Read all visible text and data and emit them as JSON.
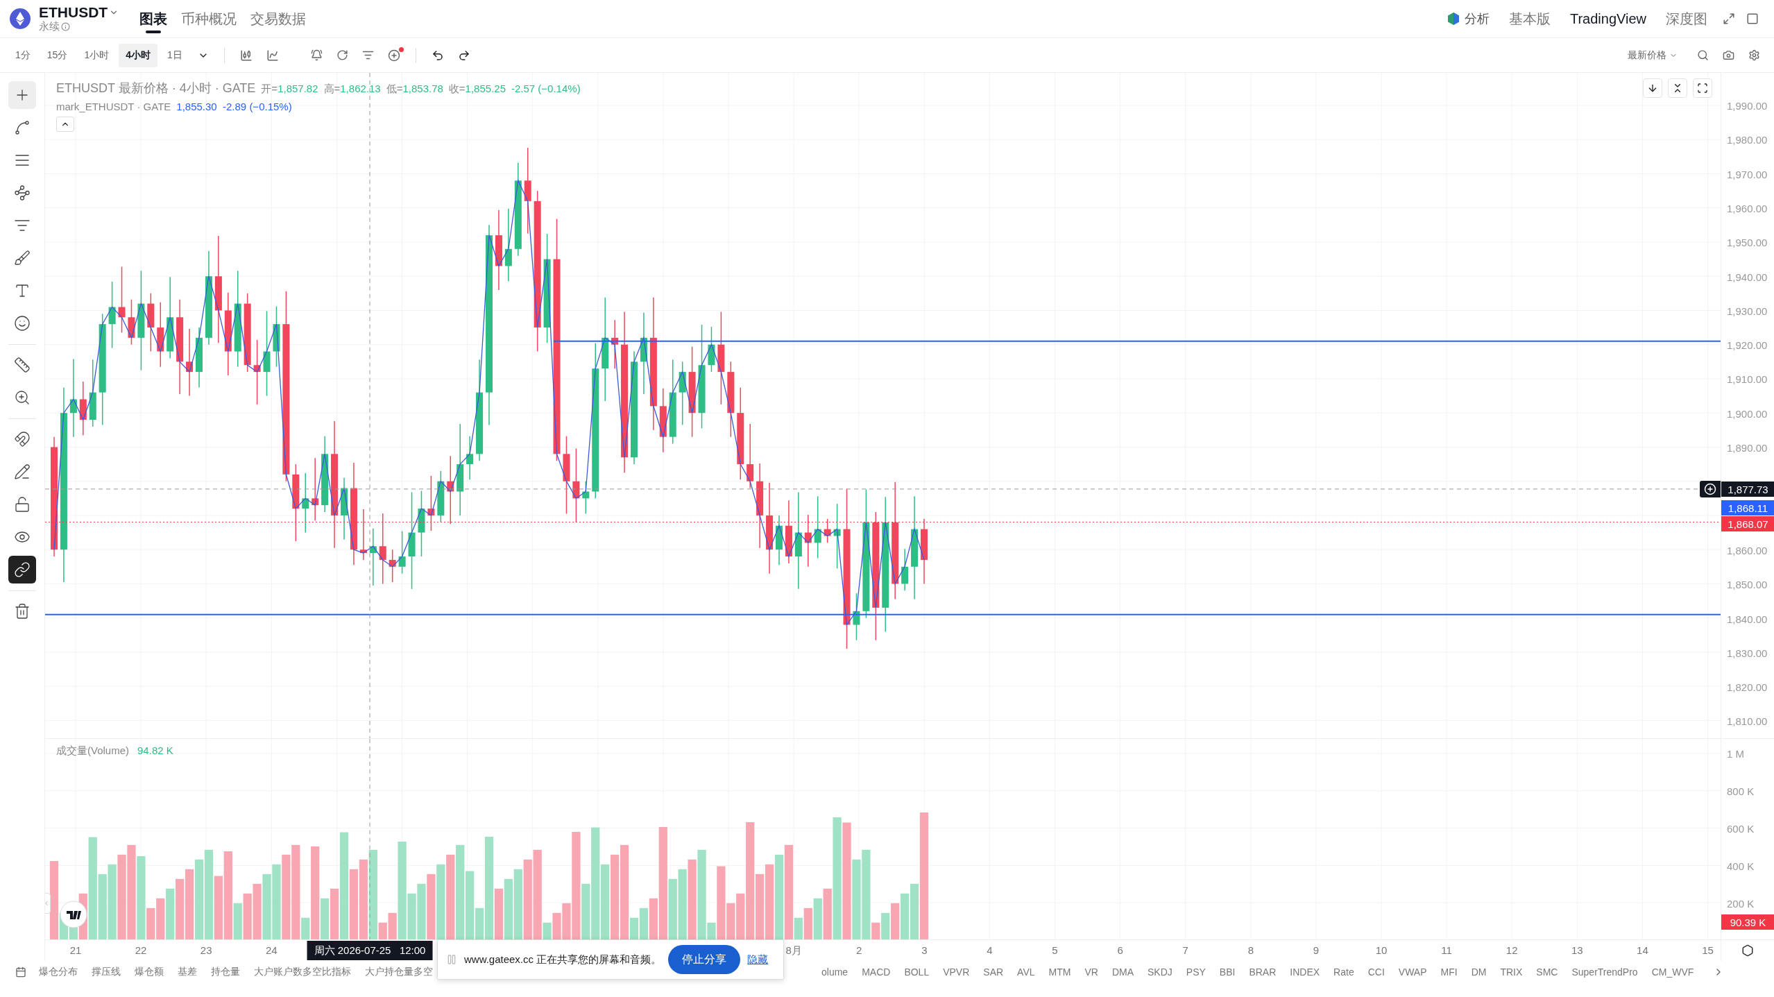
{
  "header": {
    "symbol": "ETHUSDT",
    "contract": "永续",
    "tabs": [
      {
        "label": "图表",
        "selected": true
      },
      {
        "label": "币种概况",
        "selected": false
      },
      {
        "label": "交易数据",
        "selected": false
      }
    ],
    "ai_label": "分析",
    "views": [
      {
        "label": "基本版",
        "selected": false
      },
      {
        "label": "TradingView",
        "selected": true
      },
      {
        "label": "深度图",
        "selected": false
      }
    ]
  },
  "toolbar": {
    "intervals": [
      {
        "label": "1分",
        "selected": false
      },
      {
        "label": "15分",
        "selected": false
      },
      {
        "label": "1小时",
        "selected": false
      },
      {
        "label": "4小时",
        "selected": true
      },
      {
        "label": "1日",
        "selected": false
      }
    ],
    "price_source": "最新价格"
  },
  "drawing_tools": [
    {
      "selected": true
    },
    {
      "selected": false
    },
    {
      "selected": false
    },
    {
      "selected": false
    },
    {
      "selected": false
    },
    {
      "selected": false
    },
    {
      "selected": false
    },
    {
      "selected": false
    },
    {
      "selected": false
    },
    {
      "selected": false
    },
    {
      "selected": false
    },
    {
      "selected": false
    },
    {
      "selected": false
    },
    {
      "selected": false
    },
    {
      "selected": true
    },
    {
      "selected": false
    }
  ],
  "legend": {
    "title": "ETHUSDT 最新价格 · 4小时 · GATE",
    "ohlc": [
      {
        "label": "开=",
        "value": "1,857.82"
      },
      {
        "label": "高=",
        "value": "1,862.13"
      },
      {
        "label": "低=",
        "value": "1,853.78"
      },
      {
        "label": "收=",
        "value": "1,855.25"
      }
    ],
    "change": "-2.57 (−0.14%)",
    "mark_title": "mark_ETHUSDT · GATE",
    "mark_values": "1,855.30  -2.89 (−0.15%)"
  },
  "price_axis": {
    "labels_above": [
      "1,990.00",
      "1,980.00",
      "1,970.00",
      "1,960.00",
      "1,950.00",
      "1,940.00",
      "1,930.00",
      "1,920.00",
      "1,910.00",
      "1,900.00",
      "1,890.00"
    ],
    "labels_below": [
      "1,860.00",
      "1,850.00",
      "1,840.00",
      "1,830.00",
      "1,820.00",
      "1,810.00"
    ],
    "tags": [
      {
        "text": "1,877.73",
        "color": "#131722"
      },
      {
        "text": "1,868.11",
        "color": "#2962ff"
      },
      {
        "text": "1,868.07",
        "color": "#f23645"
      }
    ]
  },
  "volume": {
    "title": "成交量(Volume)",
    "value": "94.82 K",
    "axis_labels": [
      "1 M",
      "800 K",
      "600 K",
      "400 K",
      "200 K"
    ],
    "tag": "90.39 K"
  },
  "time_axis": {
    "labels_before": [
      "21",
      "22",
      "23",
      "24"
    ],
    "labels_after": [
      "8月",
      "2",
      "3",
      "4",
      "5",
      "6",
      "7",
      "8",
      "9",
      "10",
      "11",
      "12",
      "13",
      "14",
      "15"
    ],
    "crosshair_label": "周六 2026-07-25   12:00"
  },
  "indicators_left": [
    "爆仓分布",
    "撑压线",
    "爆仓额",
    "基差",
    "持仓量",
    "大户账户数多空比指标",
    "大户持仓量多空"
  ],
  "indicators_right": [
    "olume",
    "MACD",
    "BOLL",
    "VPVR",
    "SAR",
    "AVL",
    "MTM",
    "VR",
    "DMA",
    "SKDJ",
    "PSY",
    "BBI",
    "BRAR",
    "INDEX",
    "Rate",
    "CCI",
    "VWAP",
    "MFI",
    "DM",
    "TRIX",
    "SMC",
    "SuperTrendPro",
    "CM_WVF"
  ],
  "share_bar": {
    "message": "www.gateex.cc 正在共享您的屏幕和音频。",
    "stop_button": "停止分享",
    "hide_link": "隐藏"
  }
}
